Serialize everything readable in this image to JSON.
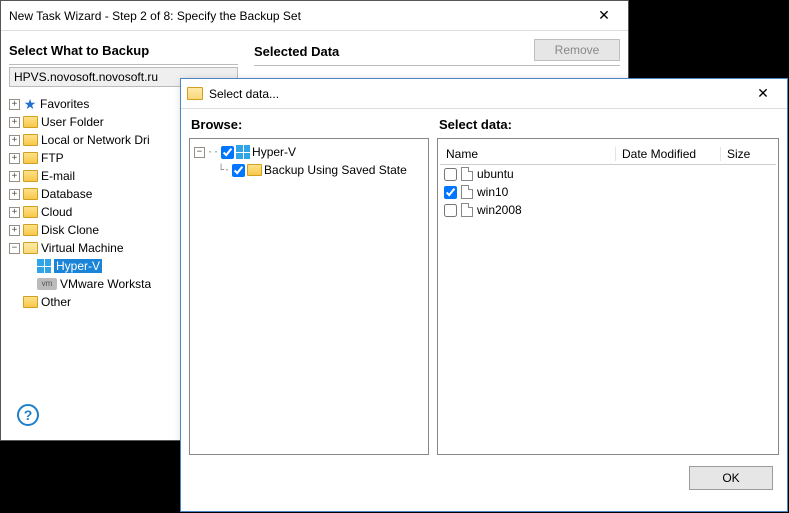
{
  "wizard": {
    "title": "New Task Wizard - Step 2 of 8: Specify the Backup Set",
    "left_header": "Select What to Backup",
    "right_header": "Selected Data",
    "remove_label": "Remove",
    "server": "HPVS.novosoft.novosoft.ru",
    "tree": {
      "favorites": "Favorites",
      "user_folder": "User Folder",
      "local_network": "Local or Network Dri",
      "ftp": "FTP",
      "email": "E-mail",
      "database": "Database",
      "cloud": "Cloud",
      "disk_clone": "Disk Clone",
      "virtual_machine": "Virtual Machine",
      "hyperv": "Hyper-V",
      "vmware": "VMware Worksta",
      "other": "Other"
    },
    "help_symbol": "?"
  },
  "dialog": {
    "title": "Select data...",
    "browse_label": "Browse:",
    "select_label": "Select data:",
    "browse_tree": {
      "root": "Hyper-V",
      "child": "Backup Using Saved State"
    },
    "columns": {
      "name": "Name",
      "date": "Date Modified",
      "size": "Size"
    },
    "items": [
      {
        "name": "ubuntu",
        "checked": false
      },
      {
        "name": "win10",
        "checked": true
      },
      {
        "name": "win2008",
        "checked": false
      }
    ],
    "ok": "OK"
  }
}
